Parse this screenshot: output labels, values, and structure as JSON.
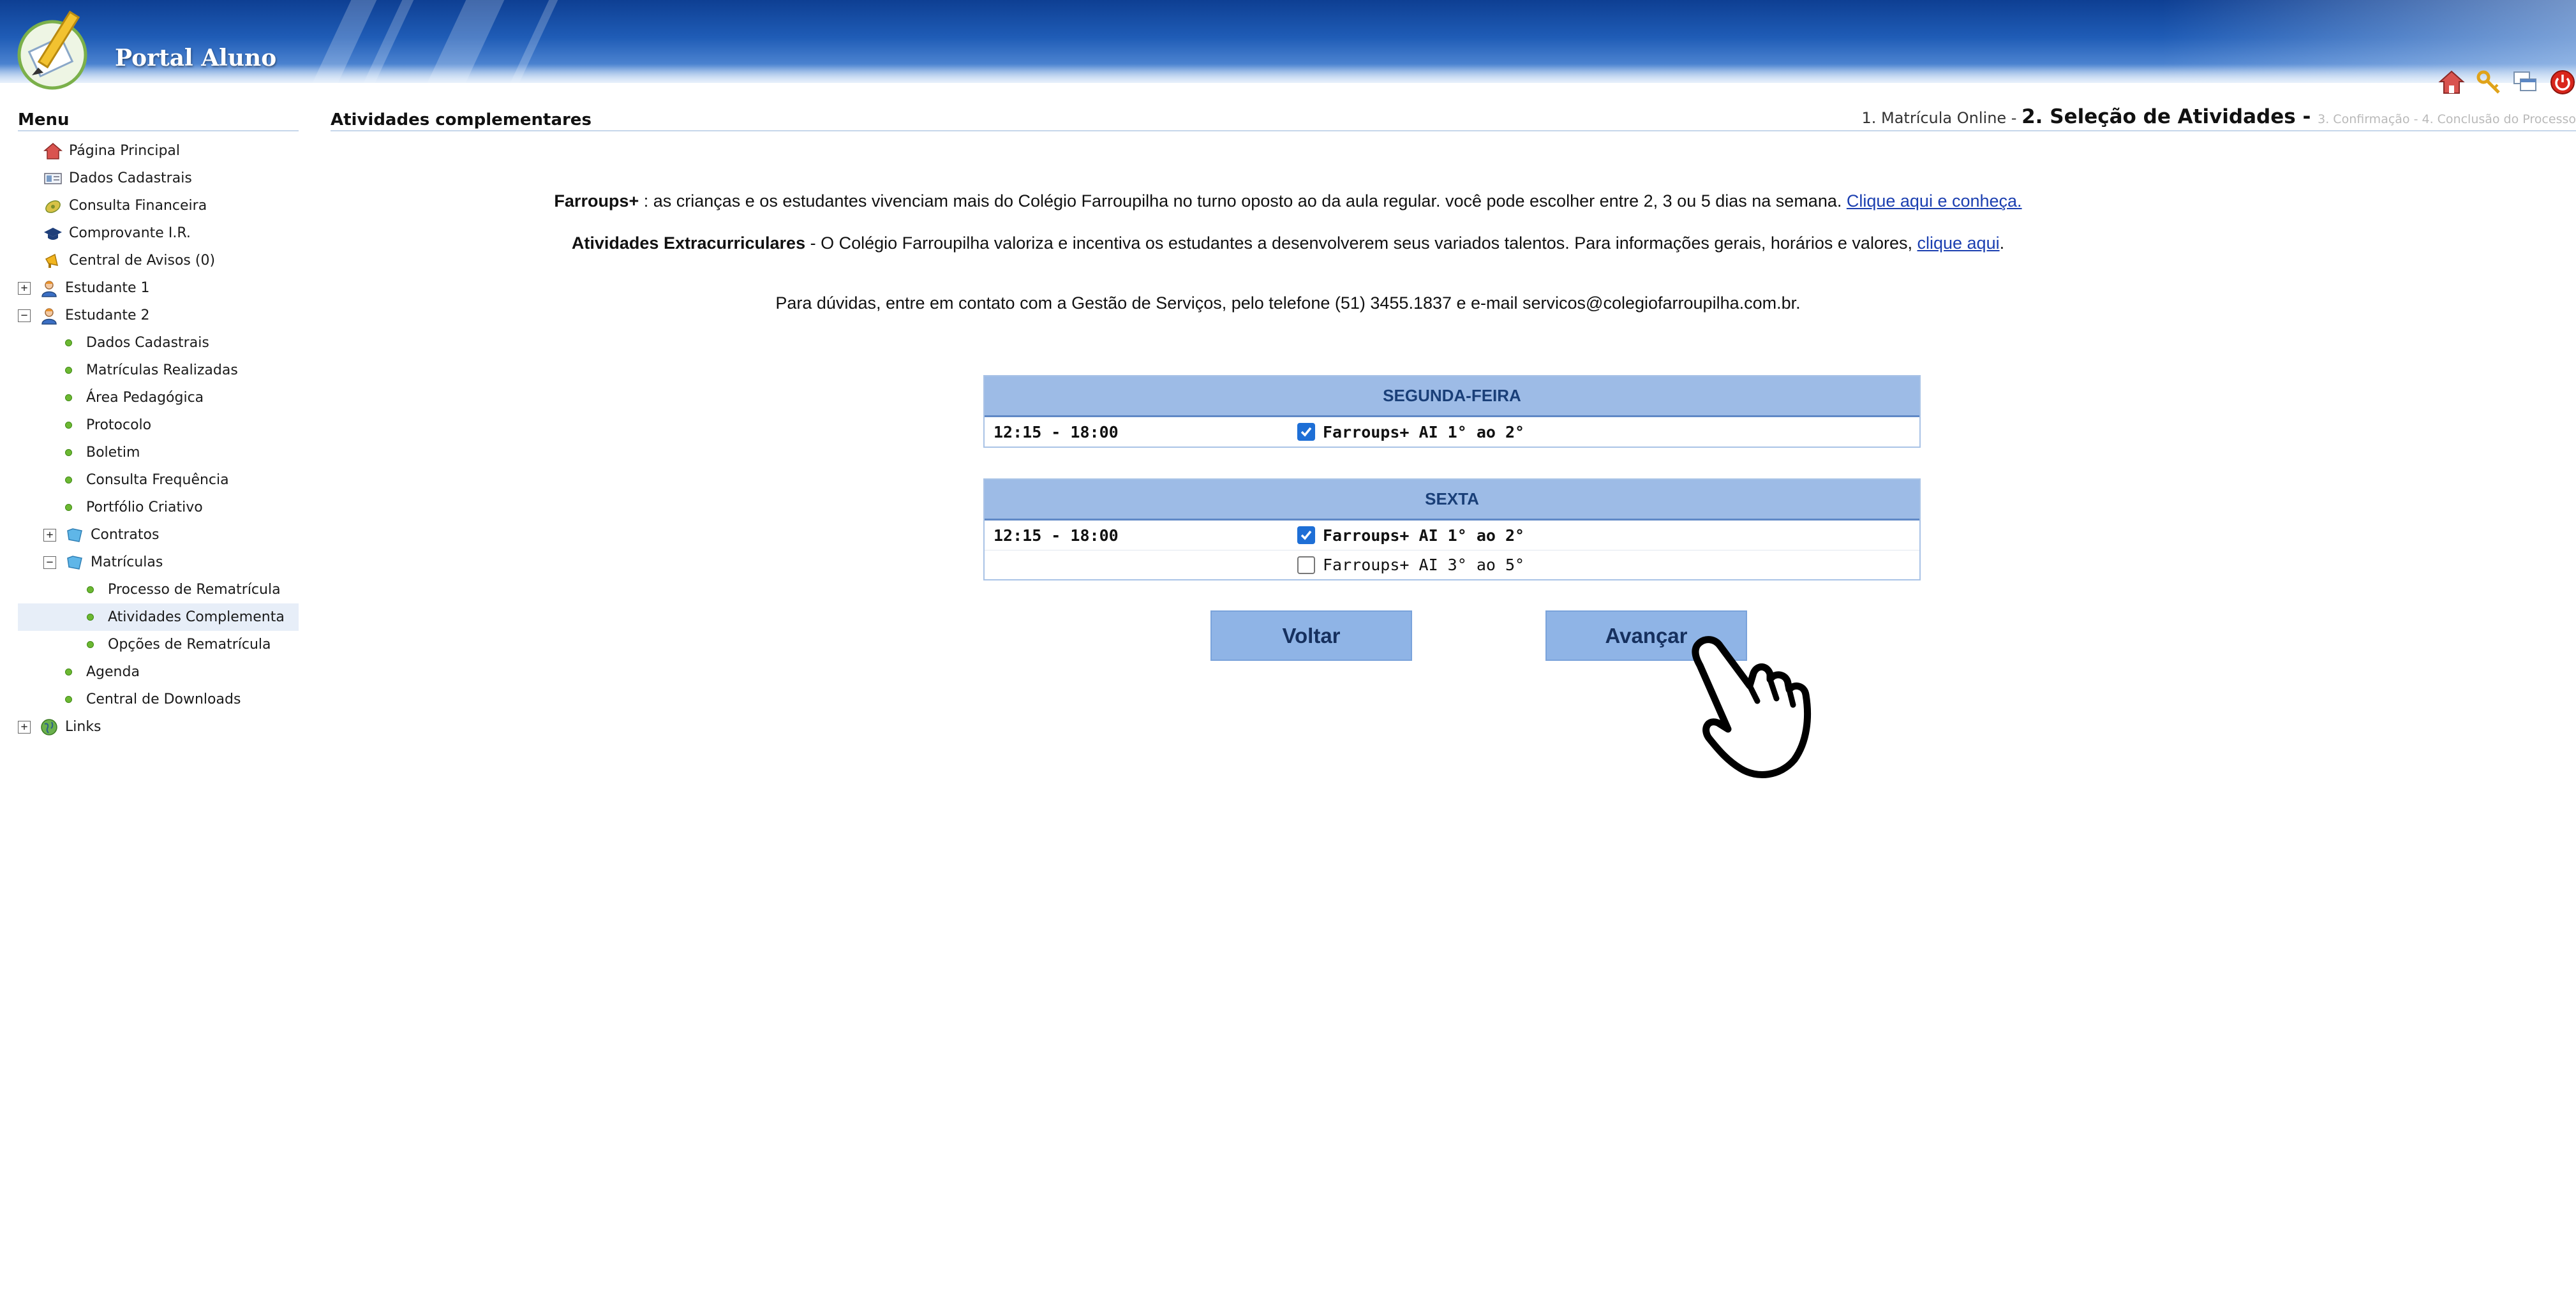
{
  "header": {
    "title": "Portal Aluno"
  },
  "menu": {
    "title": "Menu",
    "items": [
      {
        "label": "Página Principal",
        "icon": "home-icon",
        "indent": 0
      },
      {
        "label": "Dados Cadastrais",
        "icon": "id-card-icon",
        "indent": 0
      },
      {
        "label": "Consulta Financeira",
        "icon": "money-icon",
        "indent": 0
      },
      {
        "label": "Comprovante I.R.",
        "icon": "graduation-cap-icon",
        "indent": 0
      },
      {
        "label": "Central de Avisos (0)",
        "icon": "megaphone-icon",
        "indent": 0
      },
      {
        "label": "Estudante 1",
        "icon": "student-icon",
        "indent": 0,
        "expander": "+"
      },
      {
        "label": "Estudante 2",
        "icon": "student-icon",
        "indent": 0,
        "expander": "−"
      },
      {
        "label": "Dados Cadastrais",
        "indent": 1
      },
      {
        "label": "Matrículas Realizadas",
        "indent": 1
      },
      {
        "label": "Área Pedagógica",
        "indent": 1
      },
      {
        "label": "Protocolo",
        "indent": 1
      },
      {
        "label": "Boletim",
        "indent": 1
      },
      {
        "label": "Consulta Frequência",
        "indent": 1
      },
      {
        "label": "Portfólio Criativo",
        "indent": 1
      },
      {
        "label": "Contratos",
        "icon": "folder-icon",
        "indent": 1,
        "expander": "+"
      },
      {
        "label": "Matrículas",
        "icon": "folder-icon",
        "indent": 1,
        "expander": "−"
      },
      {
        "label": "Processo de Rematrícula",
        "indent": 2
      },
      {
        "label": "Atividades Complementa",
        "indent": 2,
        "selected": true
      },
      {
        "label": "Opções de Rematrícula",
        "indent": 2
      },
      {
        "label": "Agenda",
        "indent": 1
      },
      {
        "label": "Central de Downloads",
        "indent": 1
      },
      {
        "label": "Links",
        "icon": "globe-icon",
        "indent": 0,
        "expander": "+"
      }
    ]
  },
  "page": {
    "title": "Atividades complementares",
    "steps": {
      "step1": "1. Matrícula Online - ",
      "step2": "2. Seleção de Atividades - ",
      "step3": "3. Confirmação - 4. Conclusão do Processo"
    },
    "info1": {
      "bold": "Farroups+",
      "text": " : as crianças e os estudantes vivenciam mais do Colégio Farroupilha no turno oposto ao da aula regular. você pode escolher entre 2, 3 ou 5 dias na semana. ",
      "link": "Clique aqui e conheça."
    },
    "info2": {
      "bold": "Atividades Extracurriculares",
      "text": " - O Colégio Farroupilha valoriza e incentiva os estudantes a desenvolverem seus variados talentos. Para informações gerais, horários e valores, ",
      "link": "clique aqui",
      "end": "."
    },
    "info3": "Para dúvidas, entre em contato com a Gestão de Serviços, pelo telefone (51) 3455.1837 e e-mail servicos@colegiofarroupilha.com.br.",
    "days": [
      {
        "name": "SEGUNDA-FEIRA",
        "time": "12:15 - 18:00",
        "options": [
          {
            "label": "Farroups+ AI 1° ao 2°",
            "checked": true
          }
        ]
      },
      {
        "name": "SEXTA",
        "time": "12:15 - 18:00",
        "options": [
          {
            "label": "Farroups+ AI 1° ao 2°",
            "checked": true
          },
          {
            "label": "Farroups+ AI 3° ao 5°",
            "checked": false
          }
        ]
      }
    ],
    "buttons": {
      "back": "Voltar",
      "next": "Avançar"
    }
  },
  "colors": {
    "header_dark": "#0e3f93",
    "table_header": "#9dbbe6",
    "button": "#8fb4e6",
    "link": "#1b3fb0",
    "checkbox": "#1e6fd6"
  }
}
